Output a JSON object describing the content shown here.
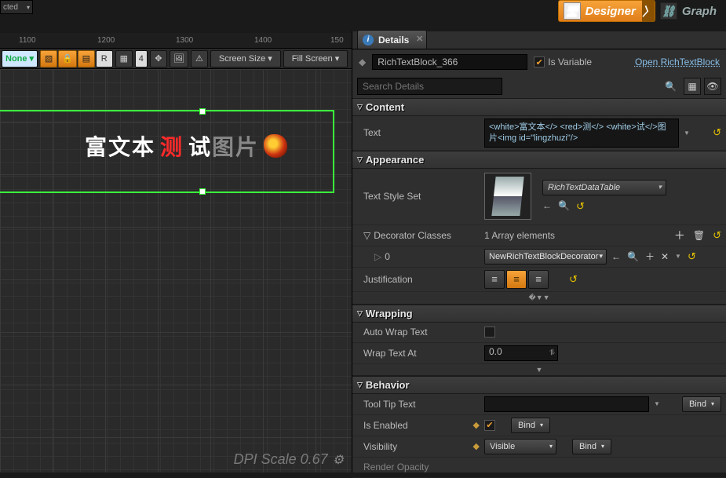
{
  "modes": {
    "designer": "Designer",
    "graph": "Graph"
  },
  "selected_dropdown": "cted",
  "ruler": {
    "ticks": [
      "1100",
      "1200",
      "1300",
      "1400",
      "150"
    ]
  },
  "toolbar": {
    "none": "None",
    "grid_num": "4",
    "r": "R",
    "screen_size": "Screen Size",
    "fill_screen": "Fill Screen"
  },
  "canvas": {
    "richtext": {
      "seg1": "富文本",
      "seg2": "测",
      "seg3": "试",
      "seg4": "图片"
    },
    "dpi": "DPI Scale 0.67"
  },
  "details": {
    "tab": "Details",
    "widget_name": "RichTextBlock_366",
    "is_variable_label": "Is Variable",
    "is_variable_checked": true,
    "open_link": "Open RichTextBlock",
    "search_placeholder": "Search Details"
  },
  "content": {
    "header": "Content",
    "text_label": "Text",
    "text_value": "<white>富文本</>  <red>测</> <white>试</>图片<img id=\"lingzhuzi\"/>"
  },
  "appearance": {
    "header": "Appearance",
    "text_style_set_label": "Text Style Set",
    "text_style_set_value": "RichTextDataTable",
    "decorator_label": "Decorator Classes",
    "decorator_count": "1 Array elements",
    "elem_index": "0",
    "elem_value": "NewRichTextBlockDecorator",
    "justification_label": "Justification"
  },
  "wrapping": {
    "header": "Wrapping",
    "auto_wrap_label": "Auto Wrap Text",
    "wrap_at_label": "Wrap Text At",
    "wrap_at_value": "0.0"
  },
  "behavior": {
    "header": "Behavior",
    "tooltip_label": "Tool Tip Text",
    "tooltip_value": "",
    "is_enabled_label": "Is Enabled",
    "visibility_label": "Visibility",
    "visibility_value": "Visible",
    "render_opacity_label": "Render Opacity",
    "bind": "Bind"
  }
}
